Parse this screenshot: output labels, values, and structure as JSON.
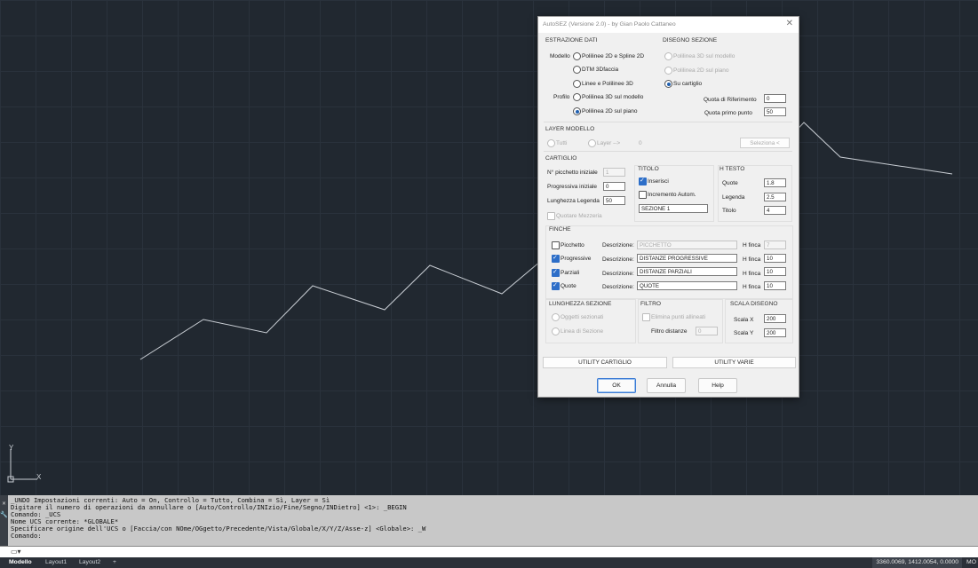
{
  "dialog": {
    "title": "AutoSEZ (Versione 2.0) - by Gian Paolo Cattaneo",
    "close_glyph": "✕",
    "estrazione": {
      "title": "ESTRAZIONE DATI",
      "modello_label": "Modello",
      "profilo_label": "Profilo",
      "options": [
        "Polilinee 2D e Spline 2D",
        "DTM 3Dfaccia",
        "Linee e Polilinee 3D",
        "Polilinea 3D sul modello",
        "Polilinea 2D sul piano"
      ],
      "selected_index": 4
    },
    "disegno": {
      "title": "DISEGNO SEZIONE",
      "options": [
        "Polilinea 3D sul modello",
        "Polilinea 2D sul piano",
        "Su cartiglio"
      ],
      "selected_index": 2,
      "quota_rif_label": "Quota di Riferimento",
      "quota_rif_value": "0",
      "quota_primo_label": "Quota primo punto",
      "quota_primo_value": "50"
    },
    "layer": {
      "title": "LAYER MODELLO",
      "tutti_label": "Tutti",
      "layer_label": "Layer -->",
      "layer_value": "0",
      "seleziona_label": "Seleziona <"
    },
    "cartiglio": {
      "title": "CARTIGLIO",
      "picchetto_label": "N° picchetto iniziale",
      "picchetto_value": "1",
      "progressiva_label": "Progressiva iniziale",
      "progressiva_value": "0",
      "legenda_label": "Lunghezza Legenda",
      "legenda_value": "50",
      "quotare_label": "Quotare Mezzeria"
    },
    "titolo": {
      "title": "TITOLO",
      "inserisci_label": "Inserisci",
      "incremento_label": "Incremento Autom.",
      "value": "SEZIONE 1"
    },
    "htesto": {
      "title": "H TESTO",
      "quote_label": "Quote",
      "quote_value": "1.8",
      "legenda_label": "Legenda",
      "legenda_value": "2.5",
      "titolo_label": "Titolo",
      "titolo_value": "4"
    },
    "finche": {
      "title": "FINCHE",
      "desc_label": "Descrizione:",
      "hfinca_label": "H finca",
      "rows": [
        {
          "name": "Picchetto",
          "desc": "PICCHETTO",
          "h": "7",
          "checked": false
        },
        {
          "name": "Progressive",
          "desc": "DISTANZE PROGRESSIVE",
          "h": "10",
          "checked": true
        },
        {
          "name": "Parziali",
          "desc": "DISTANZE PARZIALI",
          "h": "10",
          "checked": true
        },
        {
          "name": "Quote",
          "desc": "QUOTE",
          "h": "10",
          "checked": true
        }
      ]
    },
    "lunghezza": {
      "title": "LUNGHEZZA SEZIONE",
      "opt1": "Oggetti sezionati",
      "opt2": "Linea di Sezione"
    },
    "filtro": {
      "title": "FILTRO",
      "elimina_label": "Elimina punti allineati",
      "distanze_label": "Filtro distanze",
      "distanze_value": "0"
    },
    "scala": {
      "title": "SCALA DISEGNO",
      "x_label": "Scala  X",
      "x_value": "200",
      "y_label": "Scala  Y",
      "y_value": "200"
    },
    "utility_cartiglio": "UTILITY CARTIGLIO",
    "utility_varie": "UTILITY VARIE",
    "ok": "OK",
    "annulla": "Annulla",
    "help": "Help"
  },
  "ucs": {
    "x_label": "X",
    "y_label": "Y"
  },
  "command": {
    "lines": [
      "_UNDO Impostazioni correnti: Auto = On, Controllo = Tutto, Combina = Sì, Layer = Sì",
      "Digitare il numero di operazioni da annullare o [Auto/Controllo/INIzio/Fine/Segno/INDietro] <1>: _BEGIN",
      "Comando: _UCS",
      "Nome UCS corrente: *GLOBALE*",
      "Specificare origine dell'UCS o [Faccia/con NOme/OGgetto/Precedente/Vista/Globale/X/Y/Z/Asse-z] <Globale>: _W",
      "Comando:"
    ],
    "side_icons": [
      "✕",
      "🔧"
    ]
  },
  "status": {
    "tabs": [
      "Modello",
      "Layout1",
      "Layout2"
    ],
    "add_tab": "+",
    "coords": "3360.0069, 1412.0054, 0.0000",
    "mode": "MO"
  }
}
